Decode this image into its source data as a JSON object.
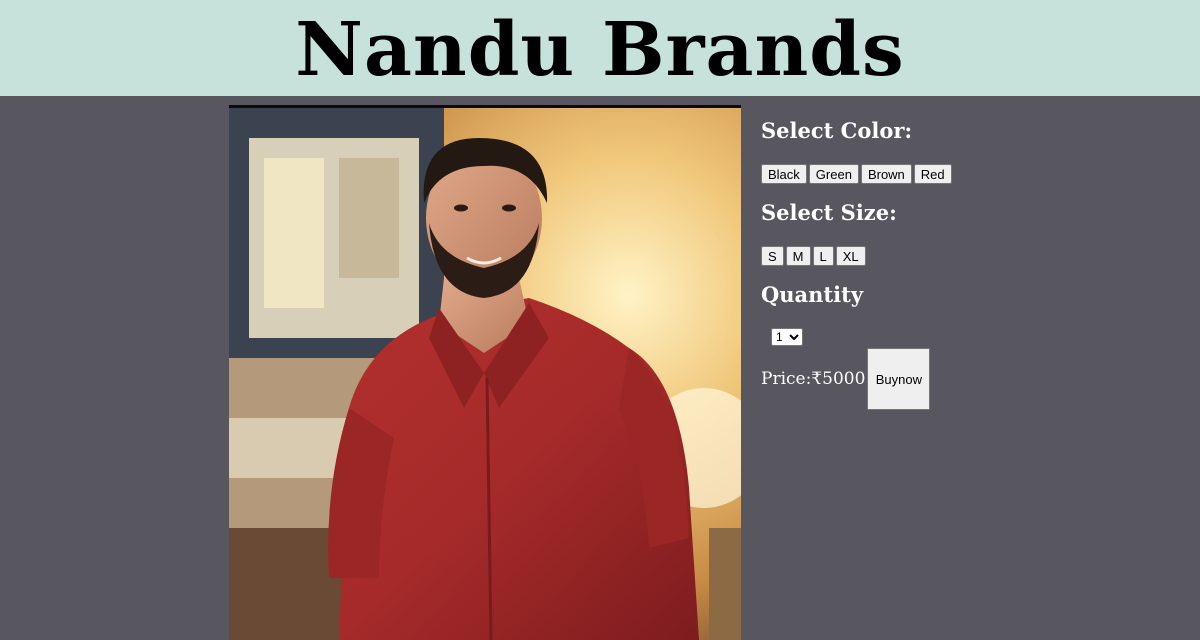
{
  "header": {
    "brand": "Nandu Brands"
  },
  "product": {
    "image_alt": "Man wearing red shirt"
  },
  "color": {
    "heading": "Select Color:",
    "options": [
      "Black",
      "Green",
      "Brown",
      "Red"
    ]
  },
  "size": {
    "heading": "Select Size:",
    "options": [
      "S",
      "M",
      "L",
      "XL"
    ]
  },
  "quantity": {
    "heading": "Quantity",
    "selected": "1"
  },
  "price": {
    "label": "Price:₹5000"
  },
  "buy": {
    "label": "Buynow"
  },
  "colors": {
    "header_bg": "#c6e2da",
    "page_bg": "#58575f",
    "shirt": "#a52a2a"
  }
}
